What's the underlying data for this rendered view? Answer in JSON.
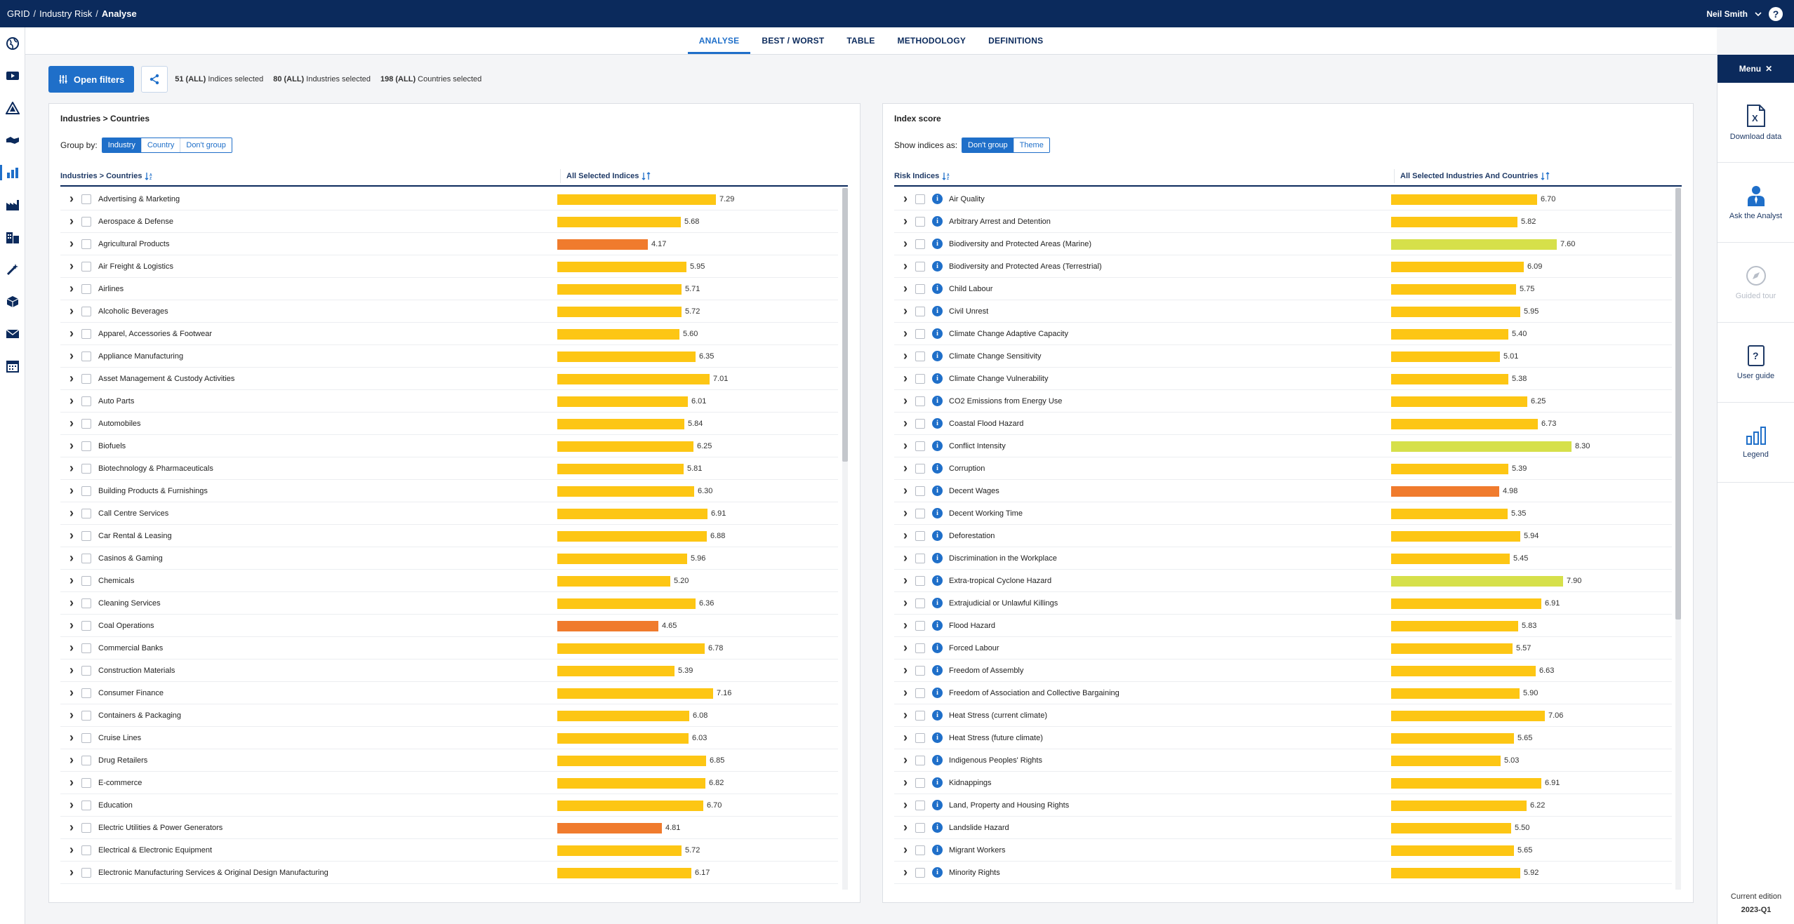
{
  "app": {
    "breadcrumb": [
      "GRID",
      "Industry Risk",
      "Analyse"
    ],
    "user": "Neil Smith",
    "help": "?"
  },
  "tabs": [
    "ANALYSE",
    "BEST / WORST",
    "TABLE",
    "METHODOLOGY",
    "DEFINITIONS"
  ],
  "active_tab": "ANALYSE",
  "filters": {
    "button_label": "Open filters",
    "indices_count": "51 (ALL)",
    "indices_label": "Indices selected",
    "industries_count": "80 (ALL)",
    "industries_label": "Industries selected",
    "countries_count": "198 (ALL)",
    "countries_label": "Countries selected"
  },
  "right_menu": {
    "header": "Menu",
    "items": [
      {
        "label": "Download data",
        "icon": "excel-icon",
        "enabled": true
      },
      {
        "label": "Ask the Analyst",
        "icon": "analyst-icon",
        "enabled": true
      },
      {
        "label": "Guided tour",
        "icon": "compass-icon",
        "enabled": false
      },
      {
        "label": "User guide",
        "icon": "book-icon",
        "enabled": true
      },
      {
        "label": "Legend",
        "icon": "bar-chart-icon",
        "enabled": true
      }
    ],
    "edition_label": "Current edition",
    "edition_value": "2023-Q1"
  },
  "colors": {
    "navy": "#0b2a5c",
    "accent": "#1f6fc9",
    "bar_yellow": "#fdc614",
    "bar_orange": "#f07b2d",
    "bar_lime": "#d6e04a"
  },
  "left_panel": {
    "title": "Industries > Countries",
    "group_label": "Group by:",
    "group_options": [
      "Industry",
      "Country",
      "Don't group"
    ],
    "group_selected": "Industry",
    "col_name": "Industries > Countries",
    "col_value": "All Selected Indices",
    "rows": [
      {
        "name": "Advertising & Marketing",
        "value": 7.29,
        "level": "medium"
      },
      {
        "name": "Aerospace & Defense",
        "value": 5.68,
        "level": "medium"
      },
      {
        "name": "Agricultural Products",
        "value": 4.17,
        "level": "high"
      },
      {
        "name": "Air Freight & Logistics",
        "value": 5.95,
        "level": "medium"
      },
      {
        "name": "Airlines",
        "value": 5.71,
        "level": "medium"
      },
      {
        "name": "Alcoholic Beverages",
        "value": 5.72,
        "level": "medium"
      },
      {
        "name": "Apparel, Accessories & Footwear",
        "value": 5.6,
        "level": "medium"
      },
      {
        "name": "Appliance Manufacturing",
        "value": 6.35,
        "level": "medium"
      },
      {
        "name": "Asset Management & Custody Activities",
        "value": 7.01,
        "level": "medium"
      },
      {
        "name": "Auto Parts",
        "value": 6.01,
        "level": "medium"
      },
      {
        "name": "Automobiles",
        "value": 5.84,
        "level": "medium"
      },
      {
        "name": "Biofuels",
        "value": 6.25,
        "level": "medium"
      },
      {
        "name": "Biotechnology & Pharmaceuticals",
        "value": 5.81,
        "level": "medium"
      },
      {
        "name": "Building Products & Furnishings",
        "value": 6.3,
        "level": "medium"
      },
      {
        "name": "Call Centre Services",
        "value": 6.91,
        "level": "medium"
      },
      {
        "name": "Car Rental & Leasing",
        "value": 6.88,
        "level": "medium"
      },
      {
        "name": "Casinos & Gaming",
        "value": 5.96,
        "level": "medium"
      },
      {
        "name": "Chemicals",
        "value": 5.2,
        "level": "medium"
      },
      {
        "name": "Cleaning Services",
        "value": 6.36,
        "level": "medium"
      },
      {
        "name": "Coal Operations",
        "value": 4.65,
        "level": "high"
      },
      {
        "name": "Commercial Banks",
        "value": 6.78,
        "level": "medium"
      },
      {
        "name": "Construction Materials",
        "value": 5.39,
        "level": "medium"
      },
      {
        "name": "Consumer Finance",
        "value": 7.16,
        "level": "medium"
      },
      {
        "name": "Containers & Packaging",
        "value": 6.08,
        "level": "medium"
      },
      {
        "name": "Cruise Lines",
        "value": 6.03,
        "level": "medium"
      },
      {
        "name": "Drug Retailers",
        "value": 6.85,
        "level": "medium"
      },
      {
        "name": "E-commerce",
        "value": 6.82,
        "level": "medium"
      },
      {
        "name": "Education",
        "value": 6.7,
        "level": "medium"
      },
      {
        "name": "Electric Utilities & Power Generators",
        "value": 4.81,
        "level": "high"
      },
      {
        "name": "Electrical & Electronic Equipment",
        "value": 5.72,
        "level": "medium"
      },
      {
        "name": "Electronic Manufacturing Services & Original Design Manufacturing",
        "value": 6.17,
        "level": "medium"
      }
    ]
  },
  "right_panel": {
    "title": "Index score",
    "show_label": "Show indices as:",
    "show_options": [
      "Don't group",
      "Theme"
    ],
    "show_selected": "Don't group",
    "col_name": "Risk Indices",
    "col_value": "All Selected Industries And Countries",
    "rows": [
      {
        "name": "Air Quality",
        "value": 6.7,
        "level": "medium"
      },
      {
        "name": "Arbitrary Arrest and Detention",
        "value": 5.82,
        "level": "medium"
      },
      {
        "name": "Biodiversity and Protected Areas (Marine)",
        "value": 7.6,
        "level": "low"
      },
      {
        "name": "Biodiversity and Protected Areas (Terrestrial)",
        "value": 6.09,
        "level": "medium"
      },
      {
        "name": "Child Labour",
        "value": 5.75,
        "level": "medium"
      },
      {
        "name": "Civil Unrest",
        "value": 5.95,
        "level": "medium"
      },
      {
        "name": "Climate Change Adaptive Capacity",
        "value": 5.4,
        "level": "medium"
      },
      {
        "name": "Climate Change Sensitivity",
        "value": 5.01,
        "level": "medium"
      },
      {
        "name": "Climate Change Vulnerability",
        "value": 5.38,
        "level": "medium"
      },
      {
        "name": "CO2 Emissions from Energy Use",
        "value": 6.25,
        "level": "medium"
      },
      {
        "name": "Coastal Flood Hazard",
        "value": 6.73,
        "level": "medium"
      },
      {
        "name": "Conflict Intensity",
        "value": 8.3,
        "level": "low"
      },
      {
        "name": "Corruption",
        "value": 5.39,
        "level": "medium"
      },
      {
        "name": "Decent Wages",
        "value": 4.98,
        "level": "high"
      },
      {
        "name": "Decent Working Time",
        "value": 5.35,
        "level": "medium"
      },
      {
        "name": "Deforestation",
        "value": 5.94,
        "level": "medium"
      },
      {
        "name": "Discrimination in the Workplace",
        "value": 5.45,
        "level": "medium"
      },
      {
        "name": "Extra-tropical Cyclone Hazard",
        "value": 7.9,
        "level": "low"
      },
      {
        "name": "Extrajudicial or Unlawful Killings",
        "value": 6.91,
        "level": "medium"
      },
      {
        "name": "Flood Hazard",
        "value": 5.83,
        "level": "medium"
      },
      {
        "name": "Forced Labour",
        "value": 5.57,
        "level": "medium"
      },
      {
        "name": "Freedom of Assembly",
        "value": 6.63,
        "level": "medium"
      },
      {
        "name": "Freedom of Association and Collective Bargaining",
        "value": 5.9,
        "level": "medium"
      },
      {
        "name": "Heat Stress (current climate)",
        "value": 7.06,
        "level": "medium"
      },
      {
        "name": "Heat Stress (future climate)",
        "value": 5.65,
        "level": "medium"
      },
      {
        "name": "Indigenous Peoples' Rights",
        "value": 5.03,
        "level": "medium"
      },
      {
        "name": "Kidnappings",
        "value": 6.91,
        "level": "medium"
      },
      {
        "name": "Land, Property and Housing Rights",
        "value": 6.22,
        "level": "medium"
      },
      {
        "name": "Landslide Hazard",
        "value": 5.5,
        "level": "medium"
      },
      {
        "name": "Migrant Workers",
        "value": 5.65,
        "level": "medium"
      },
      {
        "name": "Minority Rights",
        "value": 5.92,
        "level": "medium"
      }
    ]
  }
}
